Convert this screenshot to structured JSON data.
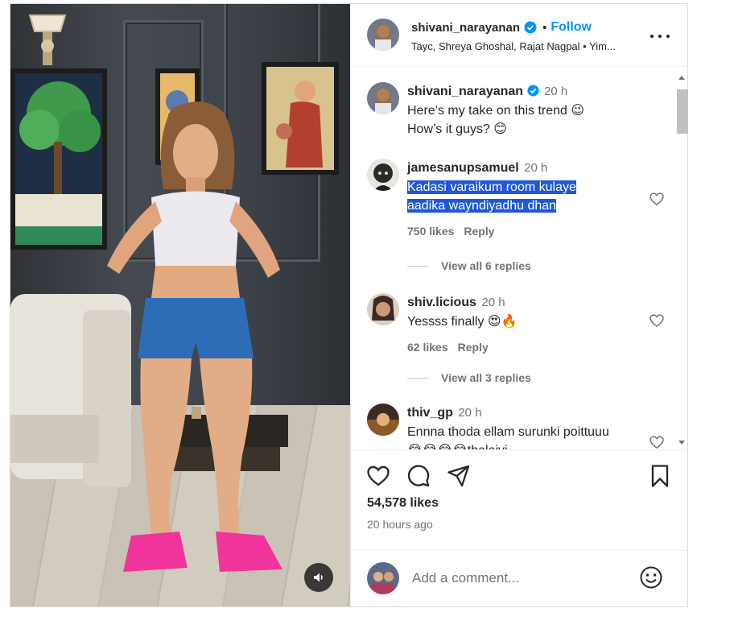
{
  "post": {
    "author": "shivani_narayanan",
    "follow_label": "Follow",
    "separator": "•",
    "audio_line": "Tayc, Shreya Ghoshal, Rajat Nagpal • Yim...",
    "caption": {
      "username": "shivani_narayanan",
      "time": "20 h",
      "line1": "Here’s my take on this trend 😉",
      "line2": "How’s it guys? 😊"
    }
  },
  "comments": [
    {
      "username": "jamesanupsamuel",
      "time": "20 h",
      "text_line1": "Kadasi varaikum room kulaye",
      "text_line2": "aadika wayndiyadhu dhan",
      "likes": "750 likes",
      "reply": "Reply",
      "view_all": "View all 6 replies"
    },
    {
      "username": "shiv.licious",
      "time": "20 h",
      "text_line1": "Yessss finally 😍🔥",
      "likes": "62 likes",
      "reply": "Reply",
      "view_all": "View all 3 replies"
    },
    {
      "username": "thiv_gp",
      "time": "20 h",
      "text_line1": "Ennna thoda ellam surunki poittuuu",
      "text_line2": "😂😂😂😂thalaivi"
    }
  ],
  "stats": {
    "likes": "54,578 likes",
    "posted": "20 hours ago"
  },
  "add_comment": {
    "placeholder": "Add a comment..."
  },
  "icons": {
    "verified": "verified-badge-icon",
    "more": "more-options-icon",
    "like": "heart-icon",
    "comment": "comment-icon",
    "share": "share-icon",
    "save": "bookmark-icon",
    "emoji": "emoji-icon",
    "sound": "speaker-icon"
  },
  "colors": {
    "accent": "#0095f6",
    "verified": "#0095f6",
    "highlight": "#1f57d6",
    "muted": "#737373"
  }
}
